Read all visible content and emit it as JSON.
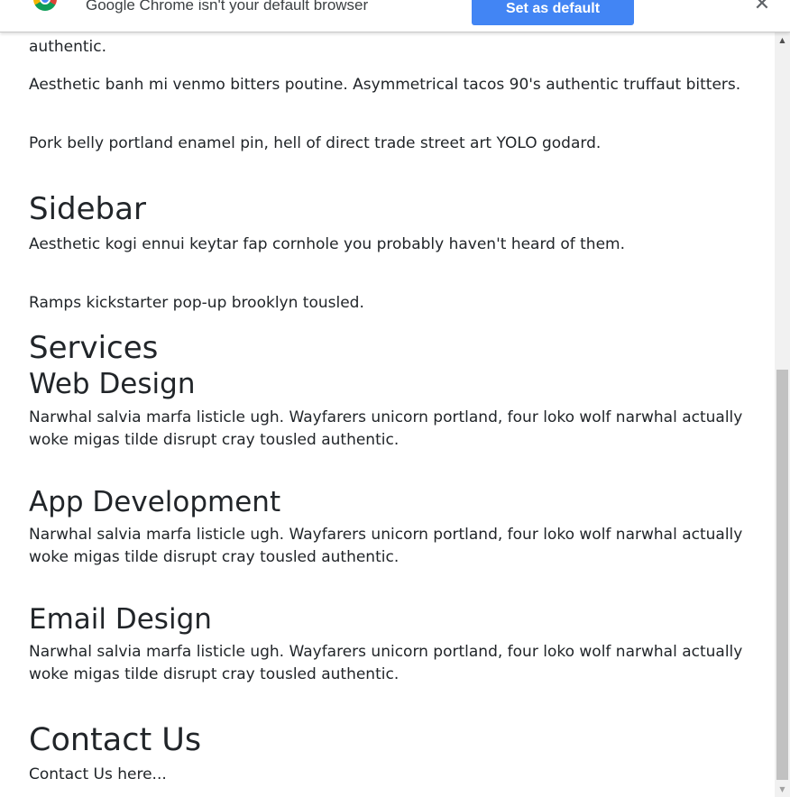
{
  "infobar": {
    "message": "Google Chrome isn't your default browser",
    "button_label": "Set as default",
    "close_glyph": "✕",
    "logo_icon": "chrome-logo-icon"
  },
  "content": {
    "cut_off_text": "authentic.",
    "para_1": "Aesthetic banh mi venmo bitters poutine. Asymmetrical tacos 90's authentic truffaut bitters.",
    "para_2": "Pork belly portland enamel pin, hell of direct trade street art YOLO godard.",
    "sidebar": {
      "heading": "Sidebar",
      "para_1": "Aesthetic kogi ennui keytar fap cornhole you probably haven't heard of them.",
      "para_2": "Ramps kickstarter pop-up brooklyn tousled."
    },
    "services": {
      "heading": "Services",
      "items": [
        {
          "title": "Web Design",
          "text": "Narwhal salvia marfa listicle ugh. Wayfarers unicorn portland, four loko wolf narwhal actually woke migas tilde disrupt cray tousled authentic."
        },
        {
          "title": "App Development",
          "text": "Narwhal salvia marfa listicle ugh. Wayfarers unicorn portland, four loko wolf narwhal actually woke migas tilde disrupt cray tousled authentic."
        },
        {
          "title": "Email Design",
          "text": "Narwhal salvia marfa listicle ugh. Wayfarers unicorn portland, four loko wolf narwhal actually woke migas tilde disrupt cray tousled authentic."
        }
      ]
    },
    "contact": {
      "heading": "Contact Us",
      "text": "Contact Us here..."
    }
  },
  "scrollbar": {
    "up_glyph": "▲",
    "down_glyph": "▼"
  },
  "colors": {
    "button_blue": "#4285f4",
    "text": "#212529",
    "scrollbar_track": "#f1f1f1",
    "scrollbar_thumb": "#c1c1c1"
  }
}
